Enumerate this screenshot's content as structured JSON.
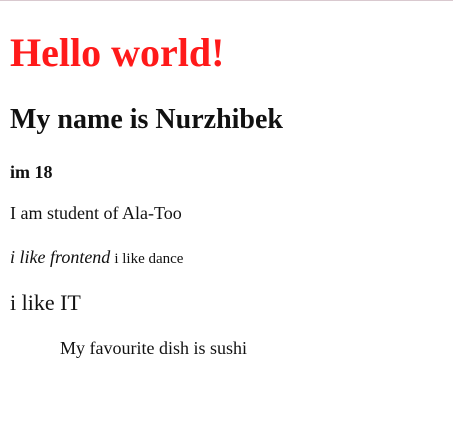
{
  "content": {
    "heading": "Hello world!",
    "subheading": "My name is Nurzhibek",
    "age": "im 18",
    "student": "I am student of Ala-Too",
    "frontend": "i like frontend",
    "dance": "i like dance",
    "it": "i like IT",
    "dish": "My favourite dish is sushi"
  },
  "colors": {
    "heading": "#ff1a1a",
    "text": "#111111",
    "top_border": "#d9c9cf",
    "background": "#ffffff"
  }
}
